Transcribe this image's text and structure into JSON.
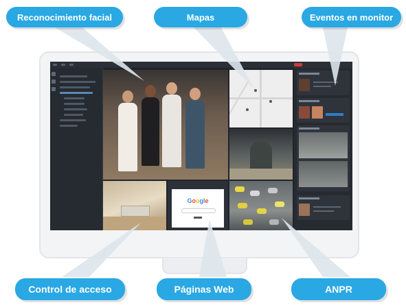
{
  "callouts": {
    "facial": "Reconocimiento facial",
    "maps": "Mapas",
    "monitor_events": "Eventos en monitor",
    "access_control": "Control de acceso",
    "web_pages": "Páginas Web",
    "anpr": "ANPR"
  },
  "web_cell": {
    "logo_letters": [
      "G",
      "o",
      "o",
      "g",
      "l",
      "e"
    ]
  },
  "colors": {
    "accent": "#29a8e3",
    "screen_bg": "#20242b",
    "alert_red": "#d23a3a"
  }
}
